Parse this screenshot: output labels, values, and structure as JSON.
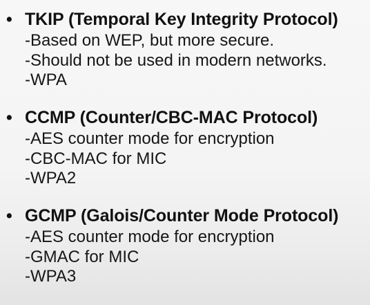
{
  "sections": [
    {
      "heading": "TKIP (Temporal Key Integrity Protocol)",
      "items": [
        "-Based on WEP, but more secure.",
        "-Should not be used in modern networks.",
        "-WPA"
      ]
    },
    {
      "heading": "CCMP (Counter/CBC-MAC Protocol)",
      "items": [
        "-AES counter mode for encryption",
        "-CBC-MAC for MIC",
        "-WPA2"
      ]
    },
    {
      "heading": "GCMP (Galois/Counter Mode Protocol)",
      "items": [
        "-AES counter mode for encryption",
        "-GMAC for MIC",
        "-WPA3"
      ]
    }
  ],
  "bullet_glyph": "•",
  "colors": {
    "text": "#111111",
    "background": "#f5f5f5"
  }
}
